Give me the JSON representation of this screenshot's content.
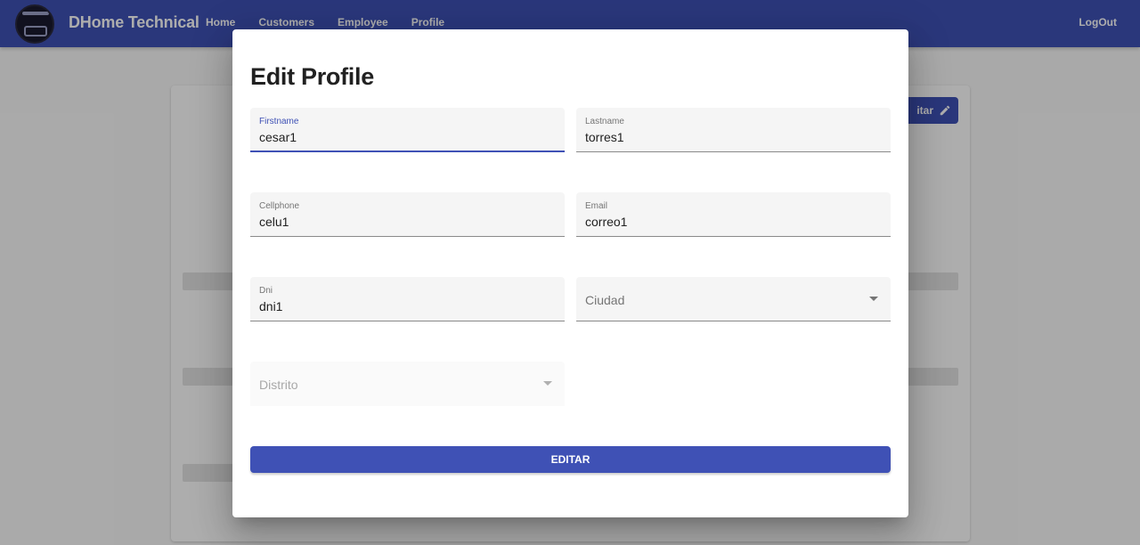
{
  "appbar": {
    "brand": "DHome Technical",
    "nav": [
      "Home",
      "Customers",
      "Employee",
      "Profile"
    ],
    "logout": "LogOut"
  },
  "background": {
    "edit_button_label": "itar"
  },
  "dialog": {
    "title": "Edit Profile",
    "fields": {
      "firstname": {
        "label": "Firstname",
        "value": "cesar1"
      },
      "lastname": {
        "label": "Lastname",
        "value": "torres1"
      },
      "cellphone": {
        "label": "Cellphone",
        "value": "celu1"
      },
      "email": {
        "label": "Email",
        "value": "correo1"
      },
      "dni": {
        "label": "Dni",
        "value": "dni1"
      },
      "ciudad": {
        "placeholder": "Ciudad"
      },
      "distrito": {
        "placeholder": "Distrito"
      }
    },
    "submit_label": "EDITAR"
  },
  "colors": {
    "primary": "#3f51b5",
    "field_bg": "#f5f5f5"
  }
}
